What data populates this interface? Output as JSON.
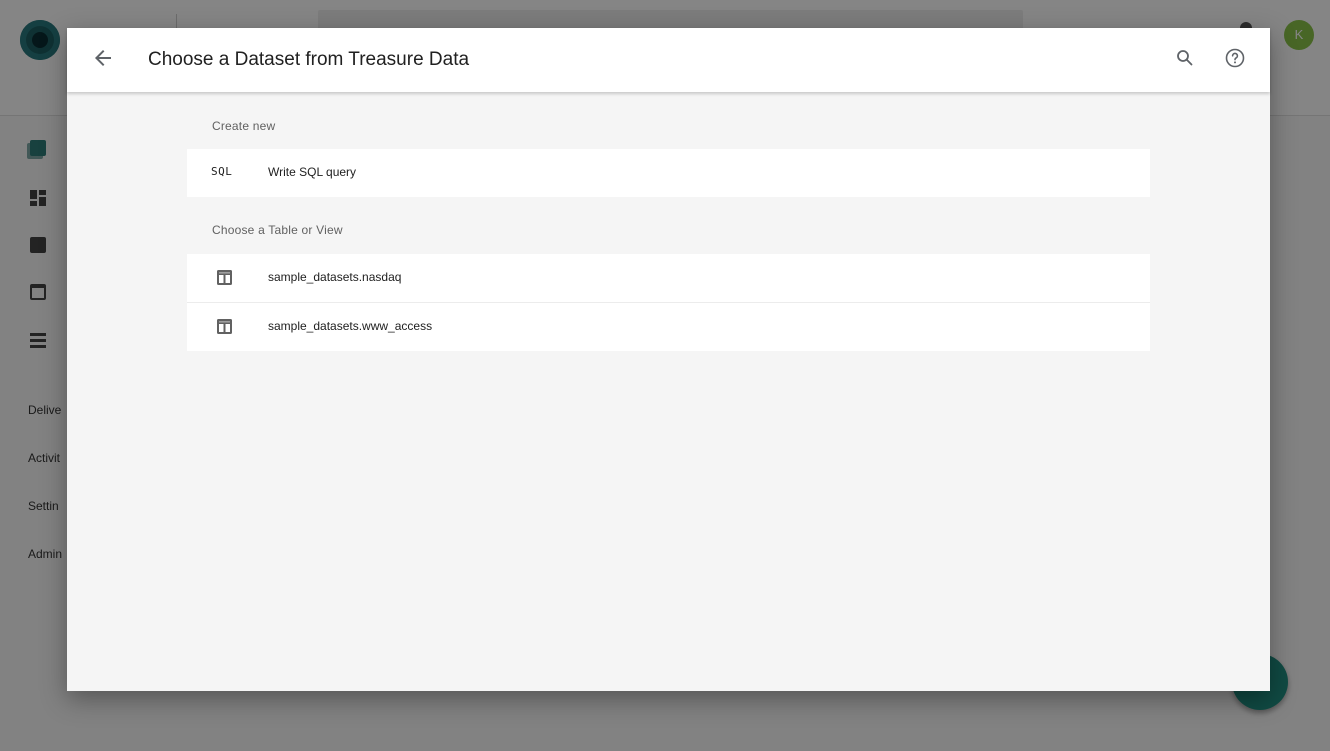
{
  "background_app": {
    "avatar_letter": "K",
    "sidebar_labels": [
      "Delive",
      "Activit",
      "Settin",
      "Admin"
    ]
  },
  "dialog": {
    "title": "Choose a Dataset from Treasure Data",
    "back_icon": "arrow-back-icon",
    "search_icon": "search-icon",
    "help_icon": "help-circle-icon",
    "create_new": {
      "label": "Create new",
      "items": [
        {
          "lead": "SQL",
          "text": "Write SQL query"
        }
      ]
    },
    "tables": {
      "label": "Choose a Table or View",
      "items": [
        {
          "icon": "table-icon",
          "text": "sample_datasets.nasdaq"
        },
        {
          "icon": "table-icon",
          "text": "sample_datasets.www_access"
        }
      ]
    }
  },
  "colors": {
    "overlay": "#000000",
    "dialog_bg": "#f5f5f5",
    "card_bg": "#ffffff",
    "accent_teal": "#1f8f80",
    "avatar": "#8bc34a"
  }
}
